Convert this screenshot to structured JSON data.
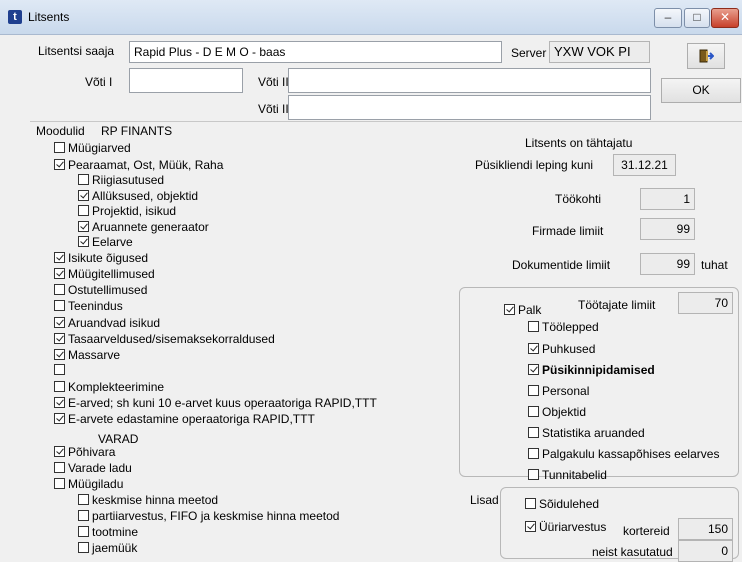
{
  "window": {
    "title": "Litsents",
    "icon": "app-logo-icon",
    "minimize": "‒",
    "maximize": "□",
    "close": "✕"
  },
  "top": {
    "licensee_label": "Litsentsi saaja",
    "licensee_value": "Rapid Plus - D E M O - baas",
    "server_label": "Server",
    "server_value": "YXW VOK PI",
    "key1_label": "Võti I",
    "key2_label": "Võti II",
    "key3_label": "Võti III",
    "key1_value": "",
    "key2_value": "",
    "key3_value": "",
    "ok_label": "OK",
    "exit_icon": "exit-door-icon"
  },
  "modules": {
    "header_label": "Moodulid",
    "header_title": "RP FINANTS",
    "items": [
      {
        "label": "Müügiarved",
        "checked": false
      },
      {
        "label": "Pearaamat, Ost, Müük, Raha",
        "checked": true
      },
      {
        "label": "Riigiasutused",
        "checked": false
      },
      {
        "label": "Allüksused, objektid",
        "checked": true
      },
      {
        "label": "Projektid, isikud",
        "checked": false
      },
      {
        "label": "Aruannete generaator",
        "checked": true
      },
      {
        "label": "Eelarve",
        "checked": true
      },
      {
        "label": "Isikute õigused",
        "checked": true
      },
      {
        "label": "Müügitellimused",
        "checked": true
      },
      {
        "label": "Ostutellimused",
        "checked": false
      },
      {
        "label": "Teenindus",
        "checked": false
      },
      {
        "label": "Aruandvad isikud",
        "checked": true
      },
      {
        "label": "Tasaarveldused/sisemaksekorraldused",
        "checked": true
      },
      {
        "label": "Massarve",
        "checked": true
      },
      {
        "label": "",
        "checked": false
      },
      {
        "label": "Komplekteerimine",
        "checked": false
      },
      {
        "label": "E-arved; sh kuni 10 e-arvet kuus operaatoriga RAPID,TTT",
        "checked": true
      },
      {
        "label": "E-arvete edastamine operaatoriga RAPID,TTT",
        "checked": true
      }
    ],
    "assets_title": "VARAD",
    "assets": [
      {
        "label": "Põhivara",
        "checked": true
      },
      {
        "label": "Varade ladu",
        "checked": false
      },
      {
        "label": "Müügiladu",
        "checked": false
      },
      {
        "label": "keskmise hinna meetod",
        "checked": false
      },
      {
        "label": "partiiarvestus, FIFO ja keskmise hinna meetod",
        "checked": false
      },
      {
        "label": "tootmine",
        "checked": false
      },
      {
        "label": "jaemüük",
        "checked": false
      }
    ]
  },
  "license": {
    "status": "Litsents on tähtajatu",
    "contract_label": "Püsikliendi leping kuni",
    "contract_value": "31.12.21",
    "workplaces_label": "Töökohti",
    "workplaces_value": "1",
    "firms_label": "Firmade limiit",
    "firms_value": "99",
    "docs_label": "Dokumentide limiit",
    "docs_value": "99",
    "docs_unit": "tuhat"
  },
  "payroll": {
    "main": {
      "label": "Palk",
      "checked": true
    },
    "employees_label": "Töötajate limiit",
    "employees_value": "70",
    "items": [
      {
        "label": "Töölepped",
        "checked": false,
        "bold": false
      },
      {
        "label": "Puhkused",
        "checked": true,
        "bold": false
      },
      {
        "label": "Püsikinnipidamised",
        "checked": true,
        "bold": true
      },
      {
        "label": "Personal",
        "checked": false,
        "bold": false
      },
      {
        "label": "Objektid",
        "checked": false,
        "bold": false
      },
      {
        "label": "Statistika aruanded",
        "checked": false,
        "bold": false
      },
      {
        "label": "Palgakulu kassapõhises eelarves",
        "checked": false,
        "bold": false
      },
      {
        "label": "Tunnitabelid",
        "checked": false,
        "bold": false
      }
    ]
  },
  "extras": {
    "title": "Lisad",
    "waybills": {
      "label": "Sõidulehed",
      "checked": false
    },
    "rent": {
      "label": "Üüriarvestus",
      "checked": true
    },
    "apartments_label": "kortereid",
    "apartments_value": "150",
    "used_label": "neist kasutatud",
    "used_value": "0"
  }
}
